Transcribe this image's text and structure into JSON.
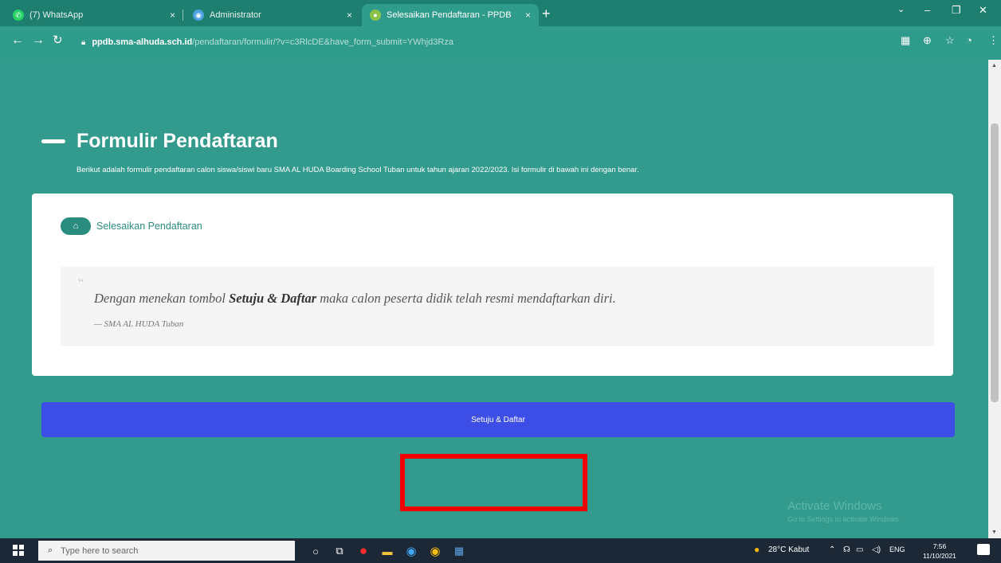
{
  "browser": {
    "tabs": [
      {
        "title": "(7) WhatsApp",
        "close": "×",
        "favicon": "whatsapp-icon",
        "color": "#25d366"
      },
      {
        "title": "Administrator",
        "close": "×",
        "favicon": "globe-icon",
        "color": "#4aa3df"
      },
      {
        "title": "Selesaikan Pendaftaran - PPDB",
        "close": "×",
        "favicon": "site-icon",
        "color": "#8bc34a"
      }
    ],
    "new_tab": "+",
    "address": {
      "host": "ppdb.sma-alhuda.sch.id",
      "path": "/pendaftaran/formulir/?v=c3RlcDE&have_form_submit=YWhjd3Rza"
    }
  },
  "page": {
    "title": "Formulir Pendaftaran",
    "subtitle": "Berikut adalah formulir pendaftaran calon siswa/siswi baru SMA AL HUDA Boarding School Tuban untuk tahun ajaran 2022/2023. Isi formulir di bawah ini dengan benar.",
    "step_label": "Selesaikan Pendaftaran",
    "quote": {
      "prefix": "Dengan menekan tombol ",
      "emphasis": "Setuju & Daftar",
      "suffix": " maka calon peserta didik telah resmi mendaftarkan diri.",
      "source": "— SMA AL HUDA Tuban"
    },
    "submit_label": "Setuju & Daftar",
    "watermark": {
      "line1": "Activate Windows",
      "line2": "Go to Settings to activate Windows."
    }
  },
  "colors": {
    "page_bg": "#329b8d",
    "accent": "#2a8c7e",
    "submit": "#3d4ee6",
    "highlight": "#f00000"
  },
  "taskbar": {
    "search_placeholder": "Type here to search",
    "weather": "28°C  Kabut",
    "lang": "ENG",
    "time": "7:56",
    "date": "11/10/2021"
  }
}
